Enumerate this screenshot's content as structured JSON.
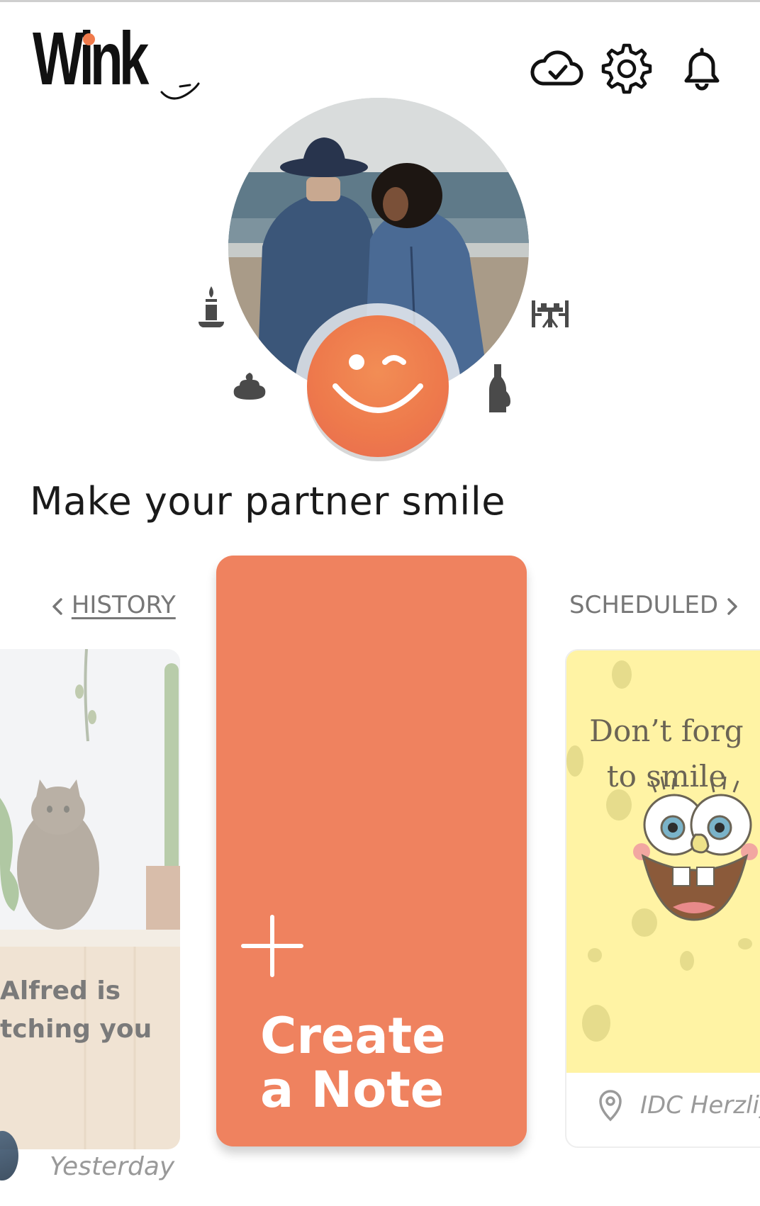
{
  "app": {
    "logo_text": "Wink"
  },
  "header": {
    "icons": [
      "cloud-sync-icon",
      "gear-icon",
      "bell-icon"
    ]
  },
  "profile": {
    "decor_icons": [
      "candle-icon",
      "dining-table-icon",
      "poop-icon",
      "wine-bottle-icon"
    ]
  },
  "tagline": "Make your partner smile",
  "carousel": {
    "history_label": "HISTORY",
    "scheduled_label": "SCHEDULED",
    "history_card": {
      "caption": "Alfred is\ntching you",
      "date": "Yesterday"
    },
    "create_card": {
      "label": "Create\na Note"
    },
    "scheduled_card": {
      "text": "Don’t forg\nto smile",
      "location": "IDC Herzliy"
    }
  },
  "colors": {
    "accent": "#ef825f",
    "wink_button": "#ee7a4c",
    "scheduled_bg": "#fff3a4"
  }
}
